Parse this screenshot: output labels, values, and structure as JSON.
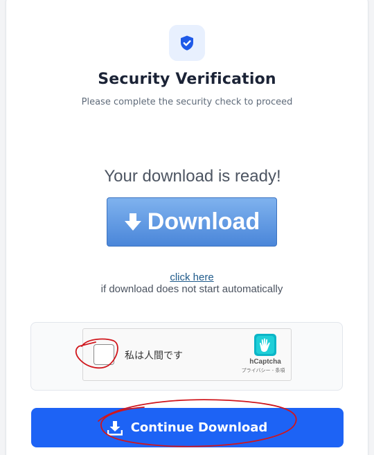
{
  "header": {
    "icon": "shield-check-icon",
    "title": "Security Verification",
    "subtitle": "Please complete the security check to proceed"
  },
  "download": {
    "ready_text": "Your download is ready!",
    "button_label": "Download",
    "button_icon": "arrow-down-icon",
    "click_here_label": "click here",
    "click_here_note": "if download does not start automatically"
  },
  "captcha": {
    "checkbox_label": "私は人間です",
    "brand": "hCaptcha",
    "links": "プライバシー - 条項",
    "logo_icon": "hcaptcha-hand-icon"
  },
  "continue": {
    "label": "Continue Download",
    "icon": "download-tray-icon"
  },
  "colors": {
    "accent": "#1d63f5",
    "shield": "#1f5ae8",
    "download_button": "#4a86d9",
    "annotation": "#d0161c"
  }
}
